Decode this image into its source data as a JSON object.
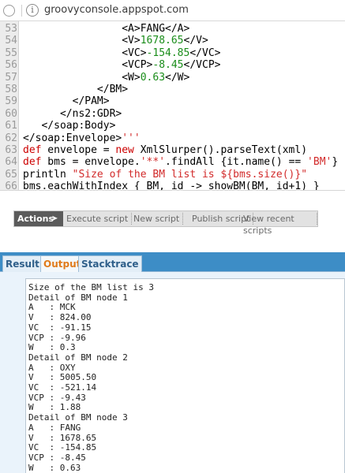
{
  "browser": {
    "url": "groovyconsole.appspot.com",
    "site_icon": "info-circle-icon"
  },
  "editor": {
    "lines": [
      {
        "num": "53",
        "parts": [
          {
            "t": "                <A>"
          },
          {
            "t": "FANG"
          },
          {
            "t": "</A>"
          }
        ]
      },
      {
        "num": "54",
        "parts": [
          {
            "t": "                <V>"
          },
          {
            "t": "1678.65",
            "c": "nm"
          },
          {
            "t": "</V>"
          }
        ]
      },
      {
        "num": "55",
        "parts": [
          {
            "t": "                <VC>"
          },
          {
            "t": "-154.85",
            "c": "nm"
          },
          {
            "t": "</VC>"
          }
        ]
      },
      {
        "num": "56",
        "parts": [
          {
            "t": "                <VCP>"
          },
          {
            "t": "-8.45",
            "c": "nm"
          },
          {
            "t": "</VCP>"
          }
        ]
      },
      {
        "num": "57",
        "parts": [
          {
            "t": "                <W>"
          },
          {
            "t": "0.63",
            "c": "nm"
          },
          {
            "t": "</W>"
          }
        ]
      },
      {
        "num": "58",
        "parts": [
          {
            "t": "            </BM>"
          }
        ]
      },
      {
        "num": "59",
        "parts": [
          {
            "t": "        </PAM>"
          }
        ]
      },
      {
        "num": "60",
        "parts": [
          {
            "t": "      </ns2:GDR>"
          }
        ]
      },
      {
        "num": "61",
        "parts": [
          {
            "t": "   </soap:Body>"
          }
        ]
      },
      {
        "num": "62",
        "parts": [
          {
            "t": "</soap:Envelope>"
          },
          {
            "t": "'''",
            "c": "st"
          }
        ]
      },
      {
        "num": "63",
        "parts": [
          {
            "t": "def",
            "c": "kw"
          },
          {
            "t": " envelope = "
          },
          {
            "t": "new",
            "c": "kw"
          },
          {
            "t": " XmlSlurper().parseText(xml)"
          }
        ]
      },
      {
        "num": "64",
        "parts": [
          {
            "t": "def",
            "c": "kw"
          },
          {
            "t": " bms = envelope."
          },
          {
            "t": "'**'",
            "c": "st"
          },
          {
            "t": ".findAll {it.name() == "
          },
          {
            "t": "'BM'",
            "c": "st"
          },
          {
            "t": "}"
          }
        ]
      },
      {
        "num": "65",
        "parts": [
          {
            "t": "println "
          },
          {
            "t": "\"Size of the BM list is ${bms.size()}\"",
            "c": "st"
          }
        ]
      },
      {
        "num": "66",
        "parts": [
          {
            "t": "bms.eachWithIndex { BM, id -> showBM(BM, id+1) }"
          }
        ]
      }
    ]
  },
  "actions": {
    "label": "Actions",
    "arrow": "➤",
    "buttons": [
      "Execute script",
      "New script",
      "Publish script",
      "View recent scripts"
    ]
  },
  "tabs": [
    {
      "label": "Result",
      "active": false
    },
    {
      "label": "Output",
      "active": true
    },
    {
      "label": "Stacktrace",
      "active": false
    }
  ],
  "output": {
    "lines": [
      "Size of the BM list is 3",
      "Detail of BM node 1",
      "A   : MCK",
      "V   : 824.00",
      "VC  : -91.15",
      "VCP : -9.96",
      "W   : 0.3",
      "Detail of BM node 2",
      "A   : OXY",
      "V   : 5005.50",
      "VC  : -521.14",
      "VCP : -9.43",
      "W   : 1.88",
      "Detail of BM node 3",
      "A   : FANG",
      "V   : 1678.65",
      "VC  : -154.85",
      "VCP : -8.45",
      "W   : 0.63"
    ]
  },
  "colors": {
    "tab_bar": "#3d8dc6",
    "active_tab_text": "#e07b1b",
    "keyword": "#cc0000",
    "number": "#1a8d1a"
  }
}
